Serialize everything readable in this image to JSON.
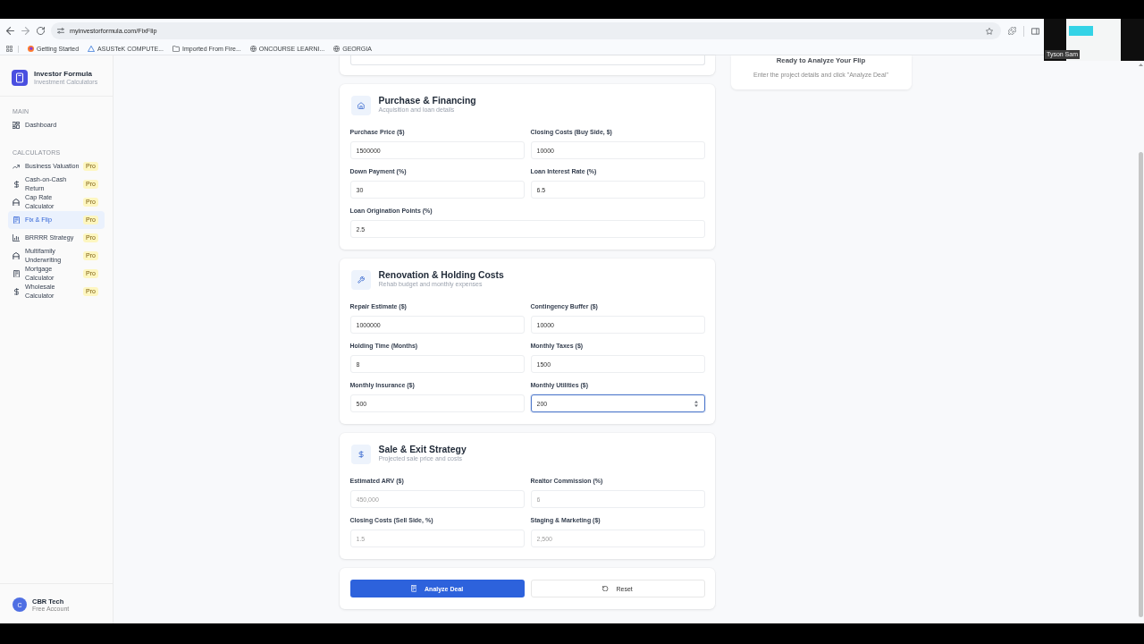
{
  "browser": {
    "url": "myinvestorformula.com/FixFlip",
    "bookmarks": [
      {
        "label": "Getting Started",
        "kind": "firefox"
      },
      {
        "label": "ASUSTeK COMPUTE...",
        "kind": "asus"
      },
      {
        "label": "Imported From Fire...",
        "kind": "folder"
      },
      {
        "label": "ONCOURSE LEARNI...",
        "kind": "globe"
      },
      {
        "label": "GEORGIA",
        "kind": "globe"
      }
    ]
  },
  "video_overlay": {
    "name": "Tyson Sam"
  },
  "sidebar": {
    "brand": {
      "title": "Investor Formula",
      "subtitle": "Investment Calculators"
    },
    "sections": [
      {
        "heading": "MAIN",
        "items": [
          {
            "label": "Dashboard",
            "kind": "grid",
            "selected": false
          }
        ]
      },
      {
        "heading": "CALCULATORS",
        "items": [
          {
            "label": "Business Valuation",
            "kind": "trend",
            "badge": "Pro",
            "selected": false
          },
          {
            "label": "Cash-on-Cash Return",
            "kind": "dollar",
            "badge": "Pro",
            "selected": false
          },
          {
            "label": "Cap Rate Calculator",
            "kind": "building",
            "badge": "Pro",
            "selected": false
          },
          {
            "label": "Fix & Flip",
            "kind": "calculator",
            "badge": "Pro",
            "selected": true
          },
          {
            "label": "BRRRR Strategy",
            "kind": "bars",
            "badge": "Pro",
            "selected": false
          },
          {
            "label": "Multifamily Underwriting",
            "kind": "building",
            "badge": "Pro",
            "selected": false
          },
          {
            "label": "Mortgage Calculator",
            "kind": "calculator",
            "badge": "Pro",
            "selected": false
          },
          {
            "label": "Wholesale Calculator",
            "kind": "dollar",
            "badge": "Pro",
            "selected": false
          }
        ]
      }
    ],
    "user": {
      "initial": "C",
      "name": "CBR Tech",
      "plan": "Free Account"
    }
  },
  "form": {
    "sections": [
      {
        "kind": "house",
        "title": "Purchase & Financing",
        "subtitle": "Acquisition and loan details",
        "fields": [
          {
            "label": "Purchase Price ($)",
            "value": "1500000",
            "focused": false
          },
          {
            "label": "Closing Costs (Buy Side, $)",
            "value": "10000",
            "focused": false
          },
          {
            "label": "Down Payment (%)",
            "value": "30",
            "focused": false
          },
          {
            "label": "Loan Interest Rate (%)",
            "value": "6.5",
            "focused": false
          },
          {
            "label": "Loan Origination Points (%)",
            "value": "2.5",
            "focused": false
          }
        ]
      },
      {
        "kind": "wrench",
        "title": "Renovation & Holding Costs",
        "subtitle": "Rehab budget and monthly expenses",
        "fields": [
          {
            "label": "Repair Estimate ($)",
            "value": "1000000",
            "focused": false
          },
          {
            "label": "Contingency Buffer ($)",
            "value": "10000",
            "focused": false
          },
          {
            "label": "Holding Time (Months)",
            "value": "8",
            "focused": false
          },
          {
            "label": "Monthly Taxes ($)",
            "value": "1500",
            "focused": false
          },
          {
            "label": "Monthly Insurance ($)",
            "value": "500",
            "focused": false
          },
          {
            "label": "Monthly Utilities ($)",
            "value": "200",
            "focused": true
          }
        ]
      },
      {
        "kind": "dollar",
        "title": "Sale & Exit Strategy",
        "subtitle": "Projected sale price and costs",
        "fields": [
          {
            "label": "Estimated ARV ($)",
            "placeholder": "450,000",
            "focused": false
          },
          {
            "label": "Realtor Commission (%)",
            "placeholder": "6",
            "focused": false
          },
          {
            "label": "Closing Costs (Sell Side, %)",
            "placeholder": "1.5",
            "focused": false
          },
          {
            "label": "Staging & Marketing ($)",
            "placeholder": "2,500",
            "focused": false
          }
        ]
      }
    ],
    "actions": [
      {
        "label": "Analyze Deal",
        "kind": "primary"
      },
      {
        "label": "Reset",
        "kind": "secondary"
      }
    ]
  },
  "result_panel": {
    "title": "Ready to Analyze Your Flip",
    "text": "Enter the project details and click \"Analyze Deal\""
  }
}
